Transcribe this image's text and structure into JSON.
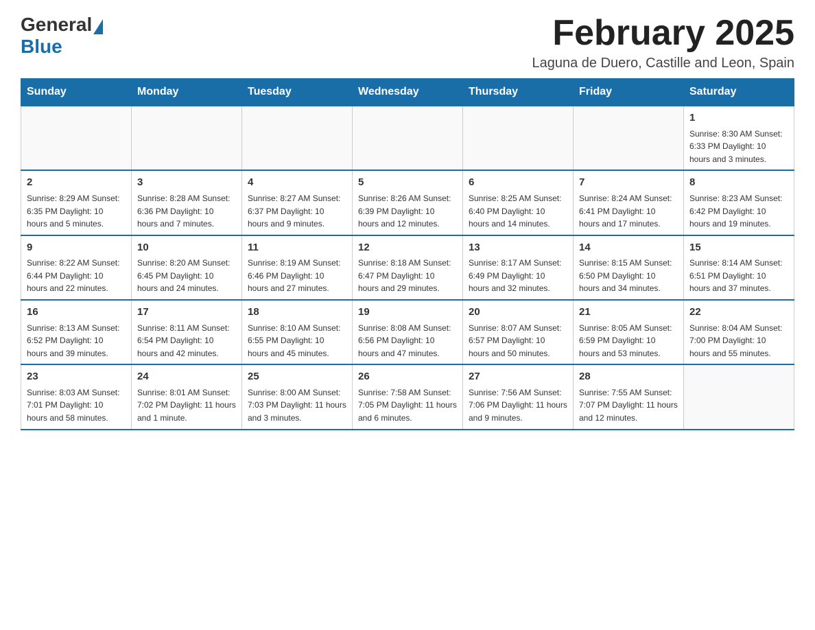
{
  "header": {
    "logo_general": "General",
    "logo_blue": "Blue",
    "month_title": "February 2025",
    "location": "Laguna de Duero, Castille and Leon, Spain"
  },
  "days_of_week": [
    "Sunday",
    "Monday",
    "Tuesday",
    "Wednesday",
    "Thursday",
    "Friday",
    "Saturday"
  ],
  "weeks": [
    {
      "days": [
        {
          "number": "",
          "info": ""
        },
        {
          "number": "",
          "info": ""
        },
        {
          "number": "",
          "info": ""
        },
        {
          "number": "",
          "info": ""
        },
        {
          "number": "",
          "info": ""
        },
        {
          "number": "",
          "info": ""
        },
        {
          "number": "1",
          "info": "Sunrise: 8:30 AM\nSunset: 6:33 PM\nDaylight: 10 hours and 3 minutes."
        }
      ]
    },
    {
      "days": [
        {
          "number": "2",
          "info": "Sunrise: 8:29 AM\nSunset: 6:35 PM\nDaylight: 10 hours and 5 minutes."
        },
        {
          "number": "3",
          "info": "Sunrise: 8:28 AM\nSunset: 6:36 PM\nDaylight: 10 hours and 7 minutes."
        },
        {
          "number": "4",
          "info": "Sunrise: 8:27 AM\nSunset: 6:37 PM\nDaylight: 10 hours and 9 minutes."
        },
        {
          "number": "5",
          "info": "Sunrise: 8:26 AM\nSunset: 6:39 PM\nDaylight: 10 hours and 12 minutes."
        },
        {
          "number": "6",
          "info": "Sunrise: 8:25 AM\nSunset: 6:40 PM\nDaylight: 10 hours and 14 minutes."
        },
        {
          "number": "7",
          "info": "Sunrise: 8:24 AM\nSunset: 6:41 PM\nDaylight: 10 hours and 17 minutes."
        },
        {
          "number": "8",
          "info": "Sunrise: 8:23 AM\nSunset: 6:42 PM\nDaylight: 10 hours and 19 minutes."
        }
      ]
    },
    {
      "days": [
        {
          "number": "9",
          "info": "Sunrise: 8:22 AM\nSunset: 6:44 PM\nDaylight: 10 hours and 22 minutes."
        },
        {
          "number": "10",
          "info": "Sunrise: 8:20 AM\nSunset: 6:45 PM\nDaylight: 10 hours and 24 minutes."
        },
        {
          "number": "11",
          "info": "Sunrise: 8:19 AM\nSunset: 6:46 PM\nDaylight: 10 hours and 27 minutes."
        },
        {
          "number": "12",
          "info": "Sunrise: 8:18 AM\nSunset: 6:47 PM\nDaylight: 10 hours and 29 minutes."
        },
        {
          "number": "13",
          "info": "Sunrise: 8:17 AM\nSunset: 6:49 PM\nDaylight: 10 hours and 32 minutes."
        },
        {
          "number": "14",
          "info": "Sunrise: 8:15 AM\nSunset: 6:50 PM\nDaylight: 10 hours and 34 minutes."
        },
        {
          "number": "15",
          "info": "Sunrise: 8:14 AM\nSunset: 6:51 PM\nDaylight: 10 hours and 37 minutes."
        }
      ]
    },
    {
      "days": [
        {
          "number": "16",
          "info": "Sunrise: 8:13 AM\nSunset: 6:52 PM\nDaylight: 10 hours and 39 minutes."
        },
        {
          "number": "17",
          "info": "Sunrise: 8:11 AM\nSunset: 6:54 PM\nDaylight: 10 hours and 42 minutes."
        },
        {
          "number": "18",
          "info": "Sunrise: 8:10 AM\nSunset: 6:55 PM\nDaylight: 10 hours and 45 minutes."
        },
        {
          "number": "19",
          "info": "Sunrise: 8:08 AM\nSunset: 6:56 PM\nDaylight: 10 hours and 47 minutes."
        },
        {
          "number": "20",
          "info": "Sunrise: 8:07 AM\nSunset: 6:57 PM\nDaylight: 10 hours and 50 minutes."
        },
        {
          "number": "21",
          "info": "Sunrise: 8:05 AM\nSunset: 6:59 PM\nDaylight: 10 hours and 53 minutes."
        },
        {
          "number": "22",
          "info": "Sunrise: 8:04 AM\nSunset: 7:00 PM\nDaylight: 10 hours and 55 minutes."
        }
      ]
    },
    {
      "days": [
        {
          "number": "23",
          "info": "Sunrise: 8:03 AM\nSunset: 7:01 PM\nDaylight: 10 hours and 58 minutes."
        },
        {
          "number": "24",
          "info": "Sunrise: 8:01 AM\nSunset: 7:02 PM\nDaylight: 11 hours and 1 minute."
        },
        {
          "number": "25",
          "info": "Sunrise: 8:00 AM\nSunset: 7:03 PM\nDaylight: 11 hours and 3 minutes."
        },
        {
          "number": "26",
          "info": "Sunrise: 7:58 AM\nSunset: 7:05 PM\nDaylight: 11 hours and 6 minutes."
        },
        {
          "number": "27",
          "info": "Sunrise: 7:56 AM\nSunset: 7:06 PM\nDaylight: 11 hours and 9 minutes."
        },
        {
          "number": "28",
          "info": "Sunrise: 7:55 AM\nSunset: 7:07 PM\nDaylight: 11 hours and 12 minutes."
        },
        {
          "number": "",
          "info": ""
        }
      ]
    }
  ]
}
